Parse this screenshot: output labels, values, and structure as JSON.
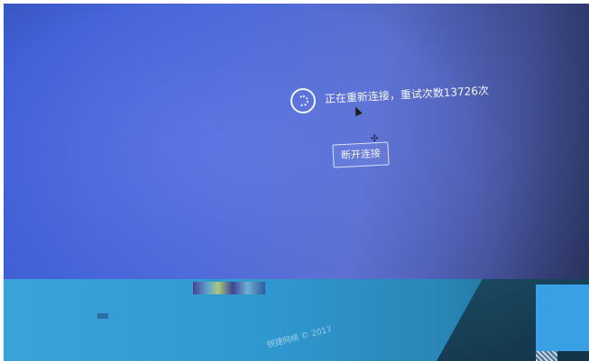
{
  "reconnect": {
    "status_text": "正在重新连接，重试次数13726次",
    "spinner_icon": "loading-spinner-icon"
  },
  "actions": {
    "disconnect_label": "断开连接"
  },
  "footer": {
    "copyright": "锐捷网络 © 2017"
  },
  "colors": {
    "screen_blue": "#4a68d8",
    "bottom_band": "#2f98cf",
    "text": "#f3f5ff"
  },
  "cursor_icons": [
    "arrow-cursor-icon",
    "move-cursor-icon"
  ]
}
